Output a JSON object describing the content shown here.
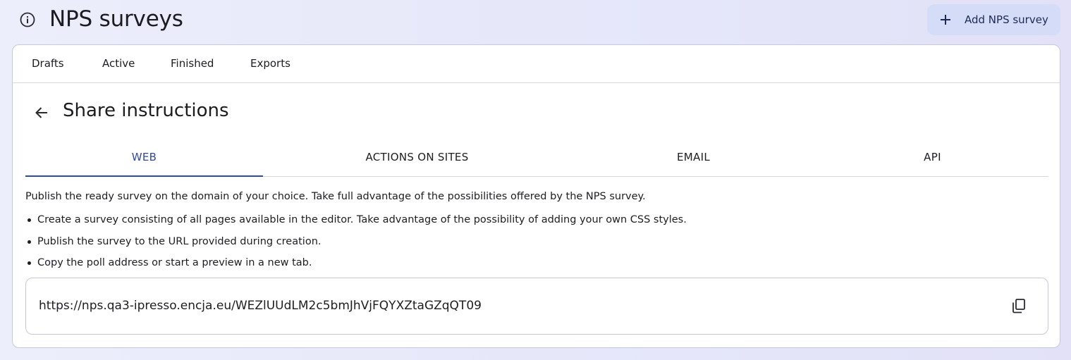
{
  "header": {
    "title": "NPS surveys",
    "info_icon": "info-circle-icon",
    "add_button_label": "Add NPS survey",
    "add_button_icon": "plus-icon"
  },
  "top_tabs": [
    {
      "label": "Drafts"
    },
    {
      "label": "Active"
    },
    {
      "label": "Finished"
    },
    {
      "label": "Exports"
    }
  ],
  "section": {
    "back_icon": "arrow-left-icon",
    "title": "Share instructions"
  },
  "share_tabs": {
    "active_index": 0,
    "items": [
      {
        "label": "WEB"
      },
      {
        "label": "ACTIONS ON SITES"
      },
      {
        "label": "EMAIL"
      },
      {
        "label": "API"
      }
    ]
  },
  "web": {
    "description": "Publish the ready survey on the domain of your choice. Take full advantage of the possibilities offered by the NPS survey.",
    "bullets": [
      "Create a survey consisting of all pages available in the editor. Take advantage of the possibility of adding your own CSS styles.",
      "Publish the survey to the URL provided during creation.",
      "Copy the poll address or start a preview in a new tab."
    ],
    "url": "https://nps.qa3-ipresso.encja.eu/WEZlUUdLM2c5bmJhVjFQYXZtaGZqQT09",
    "copy_icon": "copy-icon"
  },
  "colors": {
    "accent": "#2e4aa3",
    "button_bg": "#d5dcf7",
    "page_bg": "#e6e8fa",
    "border": "#c7c9d6"
  }
}
